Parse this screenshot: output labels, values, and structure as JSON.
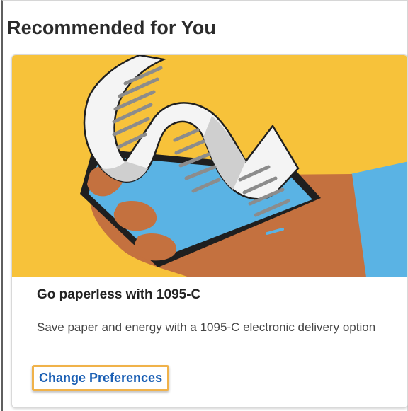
{
  "section": {
    "title": "Recommended for You"
  },
  "card": {
    "image_icon": "receipt-phone-illustration",
    "title": "Go paperless with 1095-C",
    "description": "Save paper and energy with a 1095-C electronic delivery option",
    "link_label": "Change Preferences"
  },
  "colors": {
    "illustration_background": "#f7c23a",
    "hand": "#c4713f",
    "sleeve": "#5ab3e4",
    "phone_body": "#1f1f1f",
    "phone_screen": "#5ab3e4",
    "paper": "#f4f4f4",
    "paper_shadow": "#cfcfcf",
    "text_lines": "#8c8c8c",
    "link": "#1a5fb4",
    "highlight_border": "#f0b24a"
  }
}
